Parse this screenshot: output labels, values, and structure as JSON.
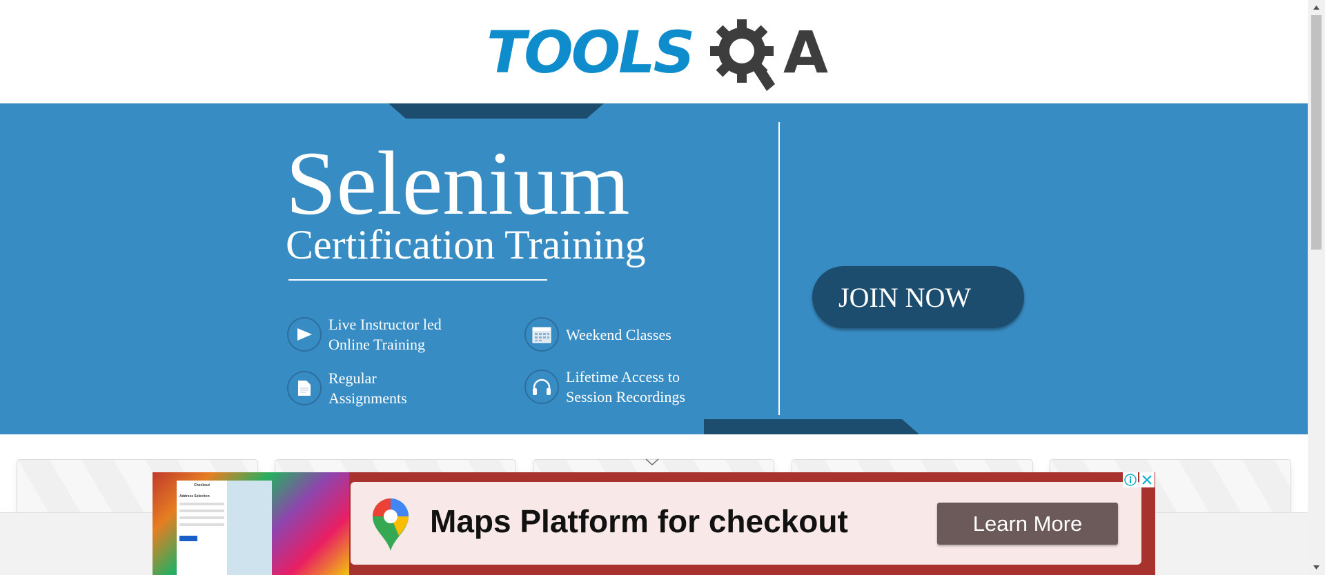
{
  "header": {
    "logo_text_blue": "TOOLS",
    "logo_text_dark": "A"
  },
  "banner": {
    "title": "Selenium",
    "subtitle": "Certification Training",
    "features": [
      {
        "icon": "play-icon",
        "label": "Live Instructor led\nOnline Training"
      },
      {
        "icon": "calendar-icon",
        "label": "Weekend Classes"
      },
      {
        "icon": "document-icon",
        "label": "Regular\nAssignments"
      },
      {
        "icon": "headphones-icon",
        "label": "Lifetime Access to\nSession Recordings"
      }
    ],
    "join_label": "JOIN NOW",
    "colors": {
      "background": "#388cc4",
      "accent": "#1c4d6e"
    }
  },
  "ad": {
    "headline": "Maps Platform for checkout",
    "cta_label": "Learn More",
    "thumb_form_title": "Checkout",
    "thumb_form_section": "Address Selection",
    "icons": [
      "maps-pin-icon",
      "ad-info-icon",
      "ad-close-icon"
    ],
    "colors": {
      "frame": "#a8322d",
      "card": "#f8e9e8",
      "button": "#6b5a59"
    }
  },
  "cards": {
    "count": 5
  }
}
